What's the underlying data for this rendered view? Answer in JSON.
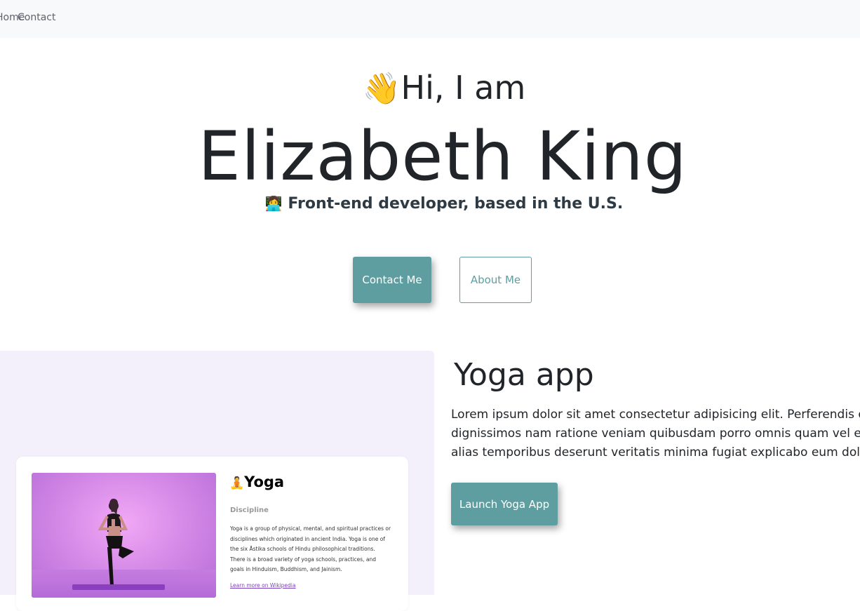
{
  "nav": {
    "home_label": "Home",
    "contact_label": "Contact"
  },
  "hero": {
    "wave_emoji": "👋",
    "greeting": "Hi, I am",
    "name": "Elizabeth King",
    "role_emoji": "👩‍💻",
    "subtitle": "Front-end developer, based in the U.S.",
    "contact_button": "Contact Me",
    "about_button": "About Me"
  },
  "project": {
    "title": "Yoga app",
    "description_lines": [
      "Lorem ipsum dolor sit amet consectetur adipisicing elit. Perferendis quia,",
      "dignissimos nam ratione veniam quibusdam porro omnis quam vel eos ev",
      "alias temporibus deserunt veritatis minima fugiat explicabo eum dolore."
    ],
    "launch_button": "Launch Yoga App",
    "preview": {
      "emoji": "🧘",
      "title": "Yoga",
      "subtitle": "Discipline",
      "body": "Yoga is a group of physical, mental, and spiritual practices or disciplines which originated in ancient India. Yoga is one of the six Āstika schools of Hindu philosophical traditions. There is a broad variety of yoga schools, practices, and goals in Hinduism, Buddhism, and Jainism.",
      "link": "Learn more on Wikipedia"
    }
  },
  "colors": {
    "accent": "#5f9ea0",
    "navbar_bg": "#f8f9fa",
    "preview_bg": "#f3f0fb"
  }
}
